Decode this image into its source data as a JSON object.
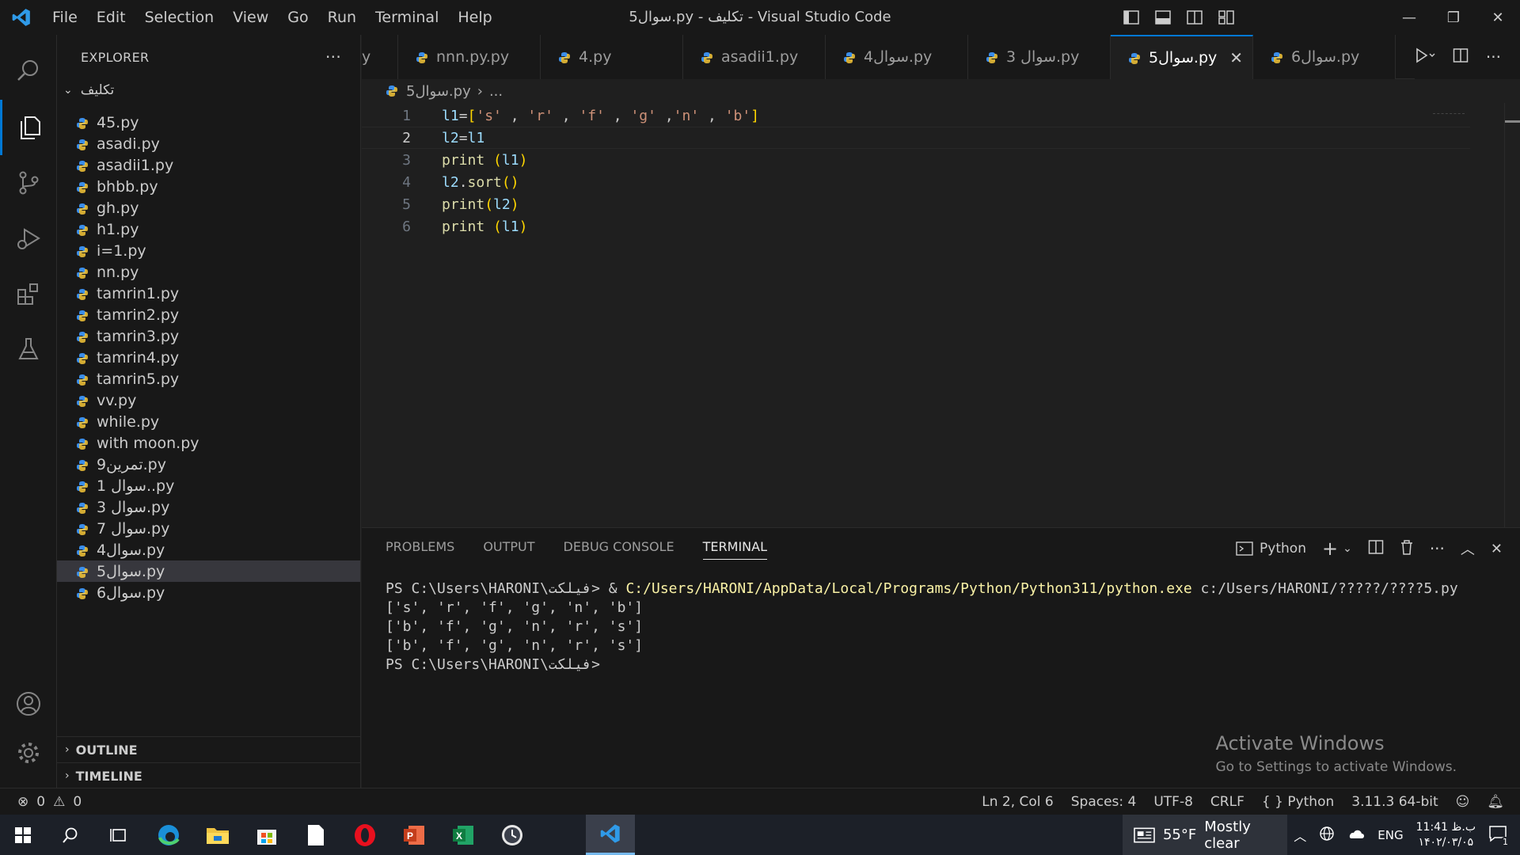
{
  "window": {
    "title": "5سوال.py - تکلیف - Visual Studio Code",
    "menu": [
      "File",
      "Edit",
      "Selection",
      "View",
      "Go",
      "Run",
      "Terminal",
      "Help"
    ]
  },
  "sidebar": {
    "header": "EXPLORER",
    "folder": "تکلیف",
    "files": [
      {
        "name": "45.py"
      },
      {
        "name": "asadi.py"
      },
      {
        "name": "asadii1.py"
      },
      {
        "name": "bhbb.py"
      },
      {
        "name": "gh.py"
      },
      {
        "name": "h1.py"
      },
      {
        "name": "i=1.py"
      },
      {
        "name": "nn.py"
      },
      {
        "name": "tamrin1.py"
      },
      {
        "name": "tamrin2.py"
      },
      {
        "name": "tamrin3.py"
      },
      {
        "name": "tamrin4.py"
      },
      {
        "name": "tamrin5.py"
      },
      {
        "name": "vv.py"
      },
      {
        "name": "while.py"
      },
      {
        "name": "with moon.py"
      },
      {
        "name": "9تمرین.py"
      },
      {
        "name": "1 سوال..py"
      },
      {
        "name": "3 سوال.py"
      },
      {
        "name": "7 سوال.py"
      },
      {
        "name": "4سوال.py"
      },
      {
        "name": "5سوال.py",
        "selected": true
      },
      {
        "name": "6سوال.py"
      }
    ],
    "outline": "OUTLINE",
    "timeline": "TIMELINE"
  },
  "tabs": [
    {
      "label": "y"
    },
    {
      "label": "nnn.py.py"
    },
    {
      "label": "4.py"
    },
    {
      "label": "asadii1.py"
    },
    {
      "label": "4سوال.py"
    },
    {
      "label": "3 سوال.py"
    },
    {
      "label": "5سوال.py",
      "active": true
    },
    {
      "label": "6سوال.py"
    }
  ],
  "breadcrumb": {
    "file": "5سوال.py",
    "more": "..."
  },
  "editor": {
    "current_line": 2,
    "lines": [
      {
        "n": "1",
        "text": "l1=['s' , 'r' , 'f' , 'g' ,'n' , 'b']"
      },
      {
        "n": "2",
        "text": "l2=l1"
      },
      {
        "n": "3",
        "text": "print (l1)"
      },
      {
        "n": "4",
        "text": "l2.sort()"
      },
      {
        "n": "5",
        "text": "print(l2)"
      },
      {
        "n": "6",
        "text": "print (l1)"
      }
    ]
  },
  "panel": {
    "tabs": [
      "PROBLEMS",
      "OUTPUT",
      "DEBUG CONSOLE",
      "TERMINAL"
    ],
    "active_tab": "TERMINAL",
    "shell_label": "Python",
    "terminal": {
      "prompt1": "PS C:\\Users\\HARONI\\فیلکت> ",
      "cmd_amp": "& ",
      "cmd_exe": "C:/Users/HARONI/AppData/Local/Programs/Python/Python311/python.exe",
      "cmd_arg": " c:/Users/HARONI/?????/????5.py",
      "out1": "['s', 'r', 'f', 'g', 'n', 'b']",
      "out2": "['b', 'f', 'g', 'n', 'r', 's']",
      "out3": "['b', 'f', 'g', 'n', 'r', 's']",
      "prompt2": "PS C:\\Users\\HARONI\\فیلکت>"
    },
    "watermark_title": "Activate Windows",
    "watermark_sub": "Go to Settings to activate Windows."
  },
  "statusbar": {
    "errors": "0",
    "warnings": "0",
    "position": "Ln 2, Col 6",
    "spaces": "Spaces: 4",
    "encoding": "UTF-8",
    "eol": "CRLF",
    "language": "Python",
    "interpreter": "3.11.3 64-bit"
  },
  "taskbar": {
    "weather_temp": "55°F",
    "weather_text": "Mostly clear",
    "lang": "ENG",
    "time": "11:41 ب.ظ",
    "date": "۱۴۰۲/۰۳/۰۵",
    "notifications": "1"
  },
  "colors": {
    "accent": "#0078d4",
    "editor_bg": "#1f1f1f",
    "sidebar_bg": "#181818",
    "python_icon": "#3b8eea"
  }
}
